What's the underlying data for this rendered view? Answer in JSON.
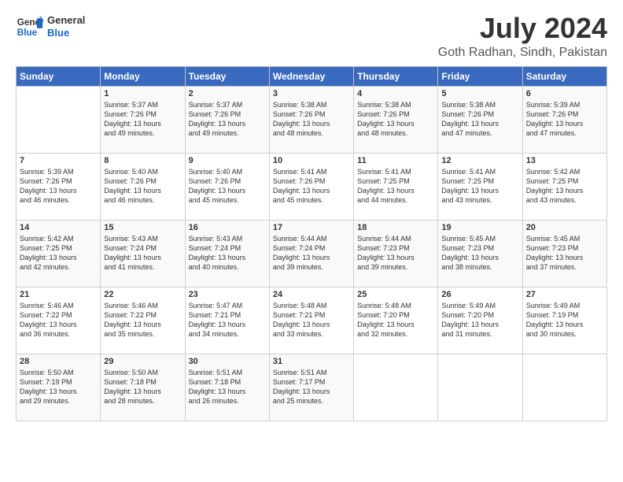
{
  "header": {
    "logo_line1": "General",
    "logo_line2": "Blue",
    "month": "July 2024",
    "location": "Goth Radhan, Sindh, Pakistan"
  },
  "columns": [
    "Sunday",
    "Monday",
    "Tuesday",
    "Wednesday",
    "Thursday",
    "Friday",
    "Saturday"
  ],
  "weeks": [
    [
      {
        "day": "",
        "info": ""
      },
      {
        "day": "1",
        "info": "Sunrise: 5:37 AM\nSunset: 7:26 PM\nDaylight: 13 hours\nand 49 minutes."
      },
      {
        "day": "2",
        "info": "Sunrise: 5:37 AM\nSunset: 7:26 PM\nDaylight: 13 hours\nand 49 minutes."
      },
      {
        "day": "3",
        "info": "Sunrise: 5:38 AM\nSunset: 7:26 PM\nDaylight: 13 hours\nand 48 minutes."
      },
      {
        "day": "4",
        "info": "Sunrise: 5:38 AM\nSunset: 7:26 PM\nDaylight: 13 hours\nand 48 minutes."
      },
      {
        "day": "5",
        "info": "Sunrise: 5:38 AM\nSunset: 7:26 PM\nDaylight: 13 hours\nand 47 minutes."
      },
      {
        "day": "6",
        "info": "Sunrise: 5:39 AM\nSunset: 7:26 PM\nDaylight: 13 hours\nand 47 minutes."
      }
    ],
    [
      {
        "day": "7",
        "info": "Sunrise: 5:39 AM\nSunset: 7:26 PM\nDaylight: 13 hours\nand 46 minutes."
      },
      {
        "day": "8",
        "info": "Sunrise: 5:40 AM\nSunset: 7:26 PM\nDaylight: 13 hours\nand 46 minutes."
      },
      {
        "day": "9",
        "info": "Sunrise: 5:40 AM\nSunset: 7:26 PM\nDaylight: 13 hours\nand 45 minutes."
      },
      {
        "day": "10",
        "info": "Sunrise: 5:41 AM\nSunset: 7:26 PM\nDaylight: 13 hours\nand 45 minutes."
      },
      {
        "day": "11",
        "info": "Sunrise: 5:41 AM\nSunset: 7:25 PM\nDaylight: 13 hours\nand 44 minutes."
      },
      {
        "day": "12",
        "info": "Sunrise: 5:41 AM\nSunset: 7:25 PM\nDaylight: 13 hours\nand 43 minutes."
      },
      {
        "day": "13",
        "info": "Sunrise: 5:42 AM\nSunset: 7:25 PM\nDaylight: 13 hours\nand 43 minutes."
      }
    ],
    [
      {
        "day": "14",
        "info": "Sunrise: 5:42 AM\nSunset: 7:25 PM\nDaylight: 13 hours\nand 42 minutes."
      },
      {
        "day": "15",
        "info": "Sunrise: 5:43 AM\nSunset: 7:24 PM\nDaylight: 13 hours\nand 41 minutes."
      },
      {
        "day": "16",
        "info": "Sunrise: 5:43 AM\nSunset: 7:24 PM\nDaylight: 13 hours\nand 40 minutes."
      },
      {
        "day": "17",
        "info": "Sunrise: 5:44 AM\nSunset: 7:24 PM\nDaylight: 13 hours\nand 39 minutes."
      },
      {
        "day": "18",
        "info": "Sunrise: 5:44 AM\nSunset: 7:23 PM\nDaylight: 13 hours\nand 39 minutes."
      },
      {
        "day": "19",
        "info": "Sunrise: 5:45 AM\nSunset: 7:23 PM\nDaylight: 13 hours\nand 38 minutes."
      },
      {
        "day": "20",
        "info": "Sunrise: 5:45 AM\nSunset: 7:23 PM\nDaylight: 13 hours\nand 37 minutes."
      }
    ],
    [
      {
        "day": "21",
        "info": "Sunrise: 5:46 AM\nSunset: 7:22 PM\nDaylight: 13 hours\nand 36 minutes."
      },
      {
        "day": "22",
        "info": "Sunrise: 5:46 AM\nSunset: 7:22 PM\nDaylight: 13 hours\nand 35 minutes."
      },
      {
        "day": "23",
        "info": "Sunrise: 5:47 AM\nSunset: 7:21 PM\nDaylight: 13 hours\nand 34 minutes."
      },
      {
        "day": "24",
        "info": "Sunrise: 5:48 AM\nSunset: 7:21 PM\nDaylight: 13 hours\nand 33 minutes."
      },
      {
        "day": "25",
        "info": "Sunrise: 5:48 AM\nSunset: 7:20 PM\nDaylight: 13 hours\nand 32 minutes."
      },
      {
        "day": "26",
        "info": "Sunrise: 5:49 AM\nSunset: 7:20 PM\nDaylight: 13 hours\nand 31 minutes."
      },
      {
        "day": "27",
        "info": "Sunrise: 5:49 AM\nSunset: 7:19 PM\nDaylight: 13 hours\nand 30 minutes."
      }
    ],
    [
      {
        "day": "28",
        "info": "Sunrise: 5:50 AM\nSunset: 7:19 PM\nDaylight: 13 hours\nand 29 minutes."
      },
      {
        "day": "29",
        "info": "Sunrise: 5:50 AM\nSunset: 7:18 PM\nDaylight: 13 hours\nand 28 minutes."
      },
      {
        "day": "30",
        "info": "Sunrise: 5:51 AM\nSunset: 7:18 PM\nDaylight: 13 hours\nand 26 minutes."
      },
      {
        "day": "31",
        "info": "Sunrise: 5:51 AM\nSunset: 7:17 PM\nDaylight: 13 hours\nand 25 minutes."
      },
      {
        "day": "",
        "info": ""
      },
      {
        "day": "",
        "info": ""
      },
      {
        "day": "",
        "info": ""
      }
    ]
  ]
}
